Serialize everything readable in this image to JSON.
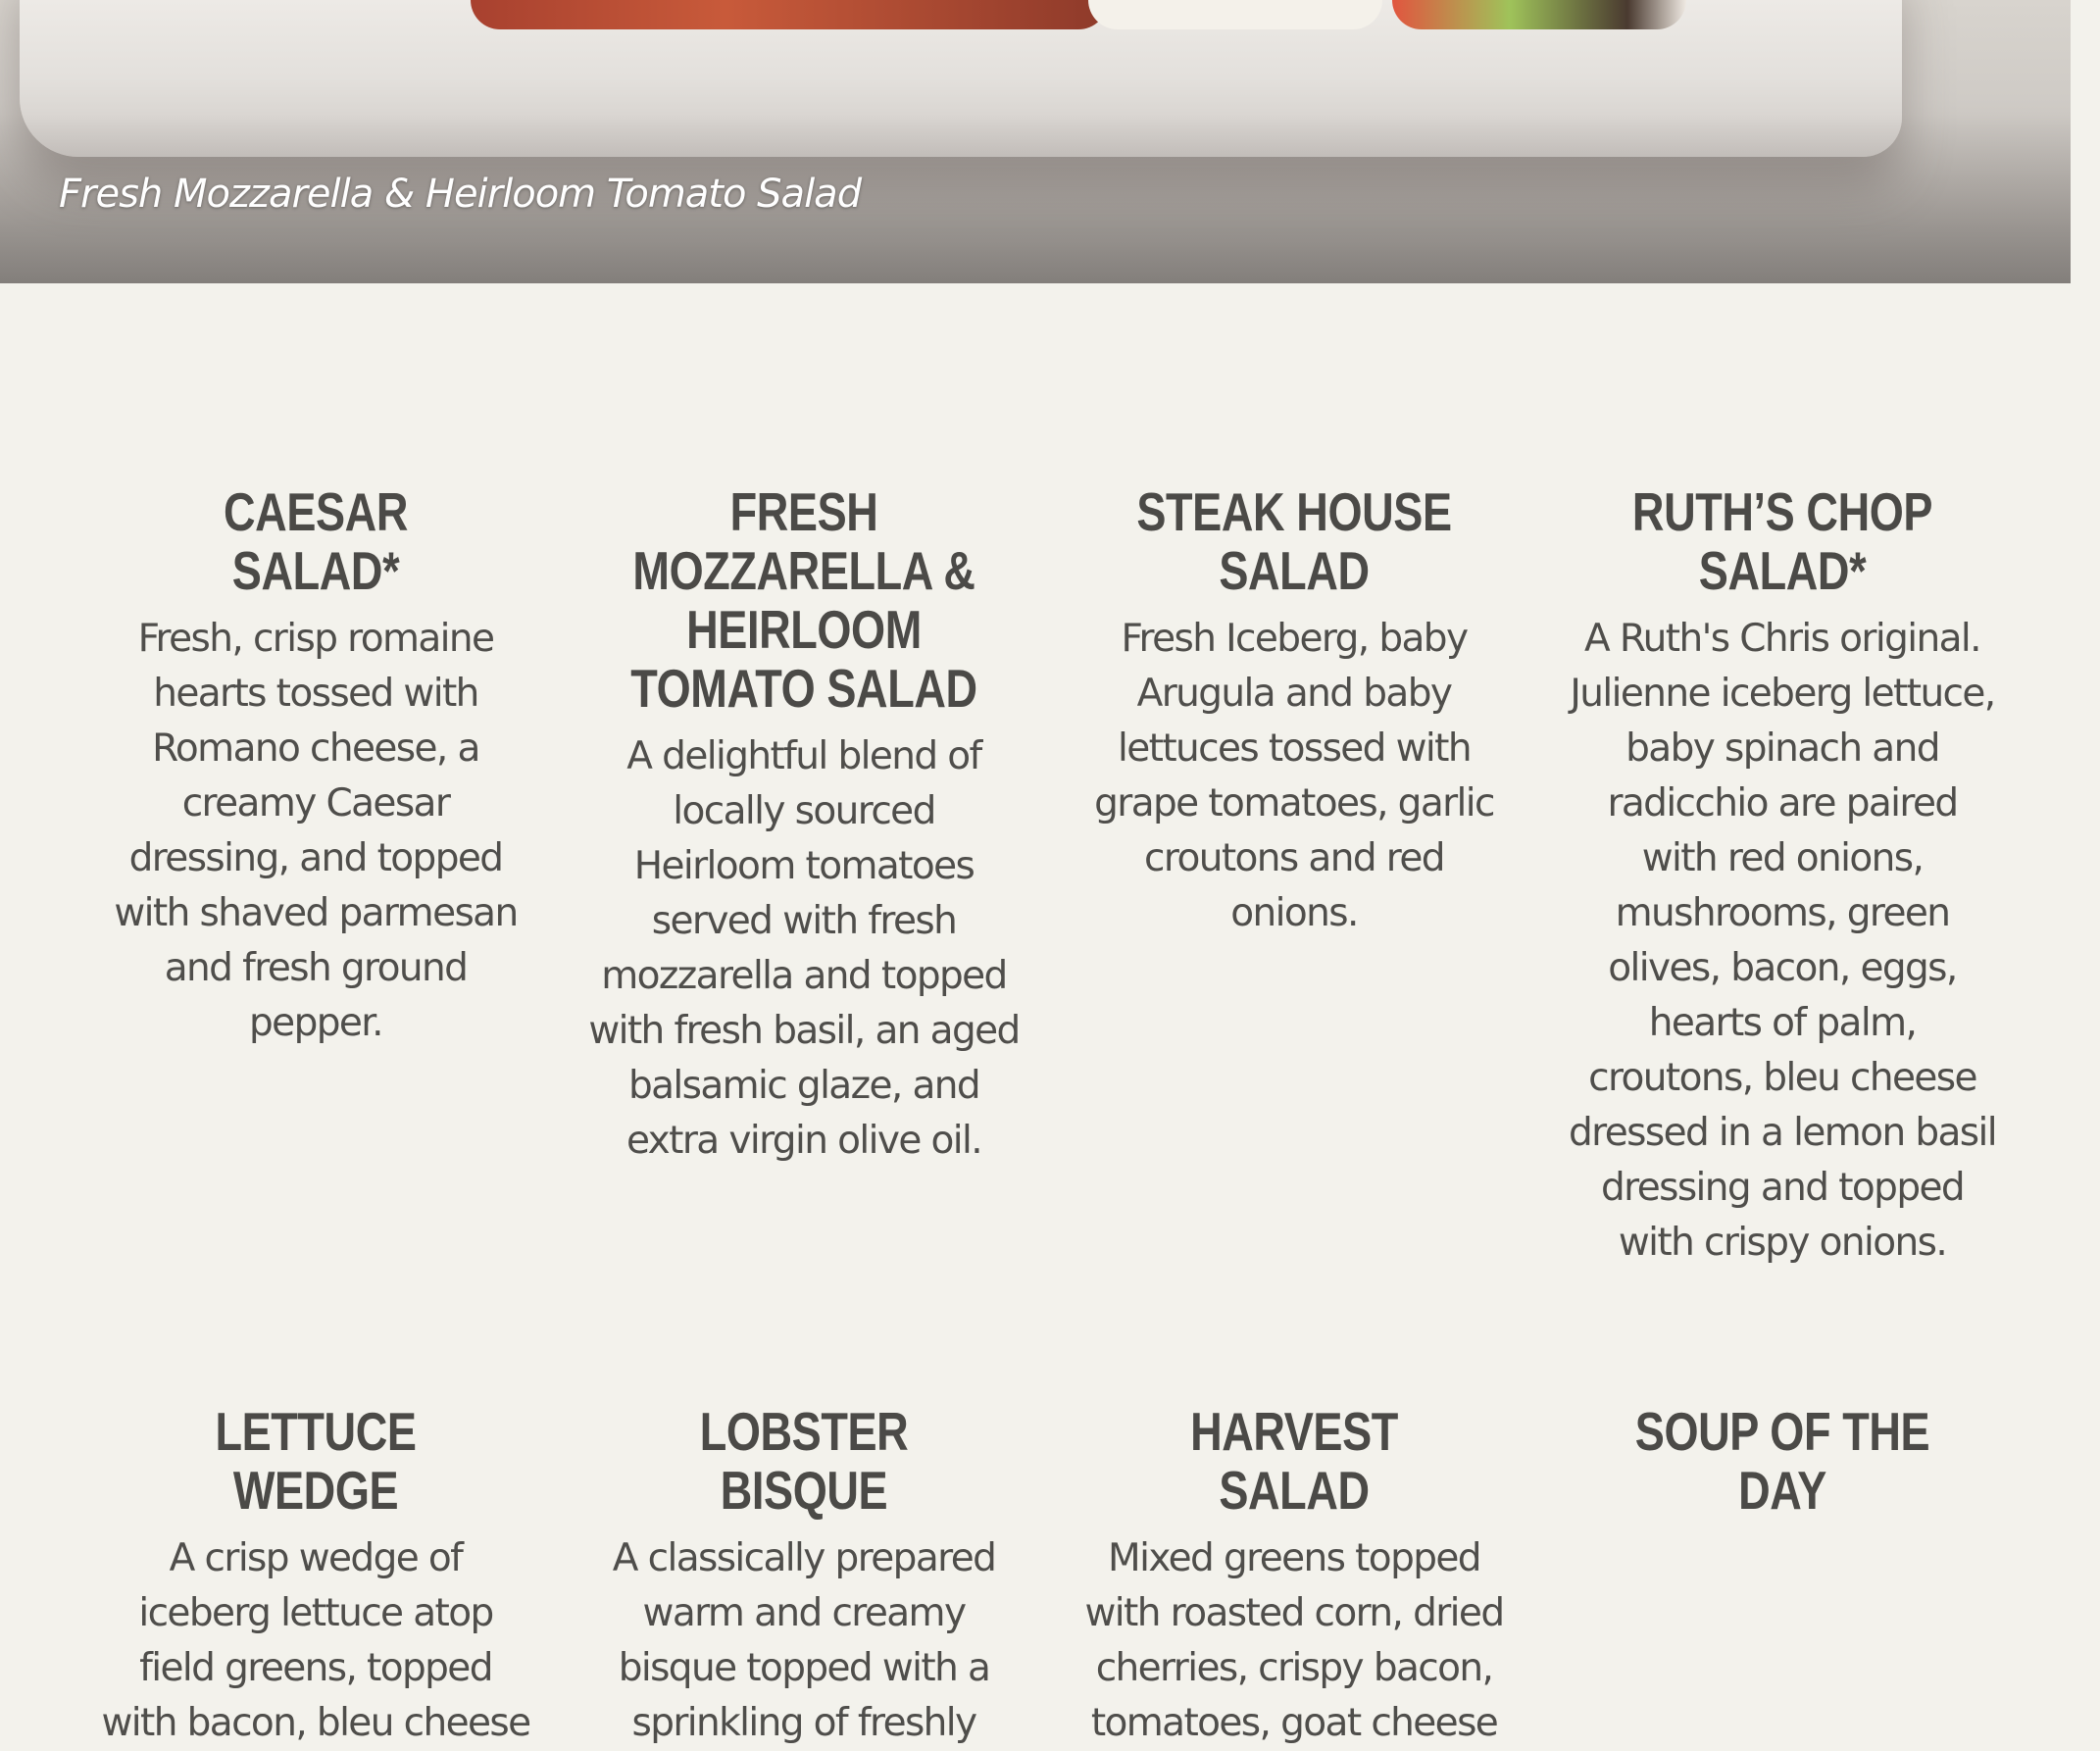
{
  "hero": {
    "caption": "Fresh Mozzarella & Heirloom Tomato Salad"
  },
  "menu": {
    "items": [
      {
        "title": "CAESAR SALAD*",
        "description": "Fresh, crisp romaine hearts tossed with Romano cheese, a creamy Caesar dressing, and topped with shaved parmesan and fresh ground pepper."
      },
      {
        "title": "FRESH MOZZARELLA & HEIRLOOM TOMATO SALAD",
        "description": "A delightful blend of locally sourced Heirloom tomatoes served with fresh mozzarella and topped with fresh basil, an aged balsamic glaze, and extra virgin olive oil."
      },
      {
        "title": "STEAK HOUSE SALAD",
        "description": "Fresh Iceberg, baby Arugula and baby lettuces tossed with grape tomatoes, garlic croutons and red onions."
      },
      {
        "title": "RUTH’S CHOP SALAD*",
        "description": "A Ruth's Chris original. Julienne iceberg lettuce, baby spinach and radicchio are paired with red onions, mushrooms, green olives, bacon, eggs, hearts of palm, croutons, bleu cheese dressed in a lemon basil dressing and topped with crispy onions."
      },
      {
        "title": "LETTUCE WEDGE",
        "description": "A crisp wedge of iceberg lettuce atop field greens, topped with bacon, bleu cheese"
      },
      {
        "title": "LOBSTER BISQUE",
        "description": "A classically prepared warm and creamy bisque topped with a sprinkling of freshly"
      },
      {
        "title": "HARVEST SALAD",
        "description": "Mixed greens topped with roasted corn, dried cherries, crispy bacon, tomatoes, goat cheese"
      },
      {
        "title": "SOUP OF THE DAY",
        "description": ""
      }
    ]
  }
}
